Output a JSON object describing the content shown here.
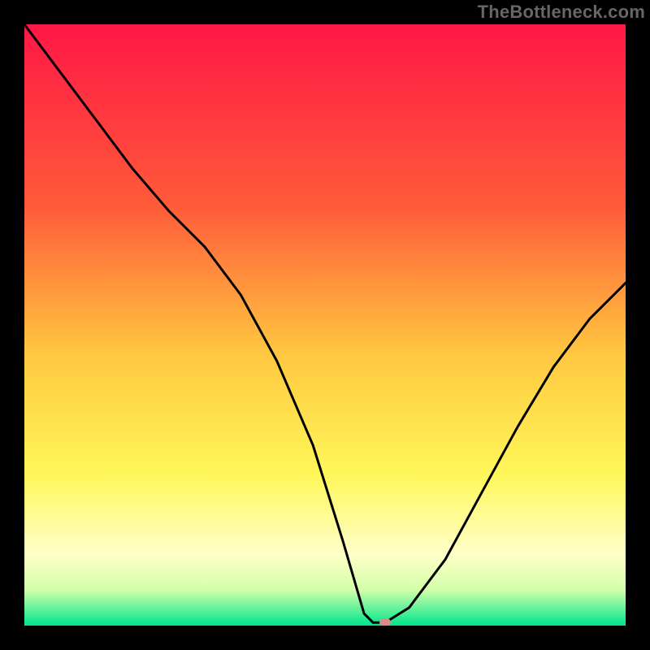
{
  "watermark_text": "TheBottleneck.com",
  "chart_data": {
    "type": "line",
    "title": "",
    "xlabel": "",
    "ylabel": "",
    "xlim": [
      0,
      100
    ],
    "ylim": [
      0,
      100
    ],
    "grid": false,
    "legend": false,
    "gradient_stops": [
      {
        "offset": 0.0,
        "color": "#ff1745"
      },
      {
        "offset": 0.3,
        "color": "#ff5a3a"
      },
      {
        "offset": 0.55,
        "color": "#ffc840"
      },
      {
        "offset": 0.75,
        "color": "#fff85a"
      },
      {
        "offset": 0.88,
        "color": "#ffffc8"
      },
      {
        "offset": 0.94,
        "color": "#d4ffaa"
      },
      {
        "offset": 1.0,
        "color": "#00e58c"
      }
    ],
    "series": [
      {
        "name": "bottleneck-curve",
        "color": "#000000",
        "x": [
          0,
          6,
          12,
          18,
          24,
          30,
          36,
          42,
          48,
          53,
          56.5,
          58,
          60,
          64,
          70,
          76,
          82,
          88,
          94,
          100
        ],
        "y": [
          100,
          92,
          84,
          76,
          69,
          63,
          55,
          44,
          30,
          14,
          2,
          0.5,
          0.5,
          3,
          11,
          22,
          33,
          43,
          51,
          57
        ]
      }
    ],
    "flat_region": {
      "x_start": 56.5,
      "x_end": 60.5,
      "y": 0.5
    },
    "marker": {
      "x": 60,
      "y": 0.5,
      "color": "#d98b84"
    }
  }
}
